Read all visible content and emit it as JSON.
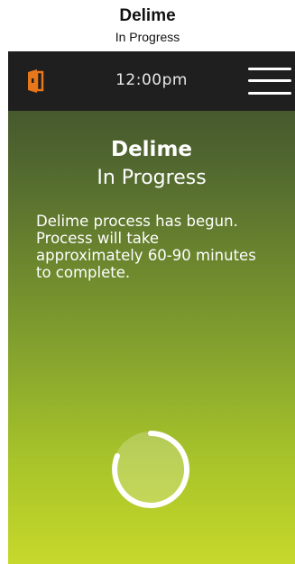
{
  "caption": {
    "title": "Delime",
    "subtitle": "In Progress"
  },
  "topbar": {
    "time": "12:00pm",
    "logo_icon": "door-icon",
    "menu_icon": "hamburger-menu-icon"
  },
  "screen": {
    "title": "Delime",
    "subtitle": "In Progress",
    "message": "Delime process has begun. Process will take approximately 60-90 minutes to complete.",
    "spinner_icon": "loading-spinner-icon"
  },
  "colors": {
    "topbar_bg": "#1f1f1f",
    "logo_accent": "#e8761b",
    "gradient_top": "#3a4a2a",
    "gradient_bottom": "#c6d82b",
    "text": "#ffffff"
  }
}
